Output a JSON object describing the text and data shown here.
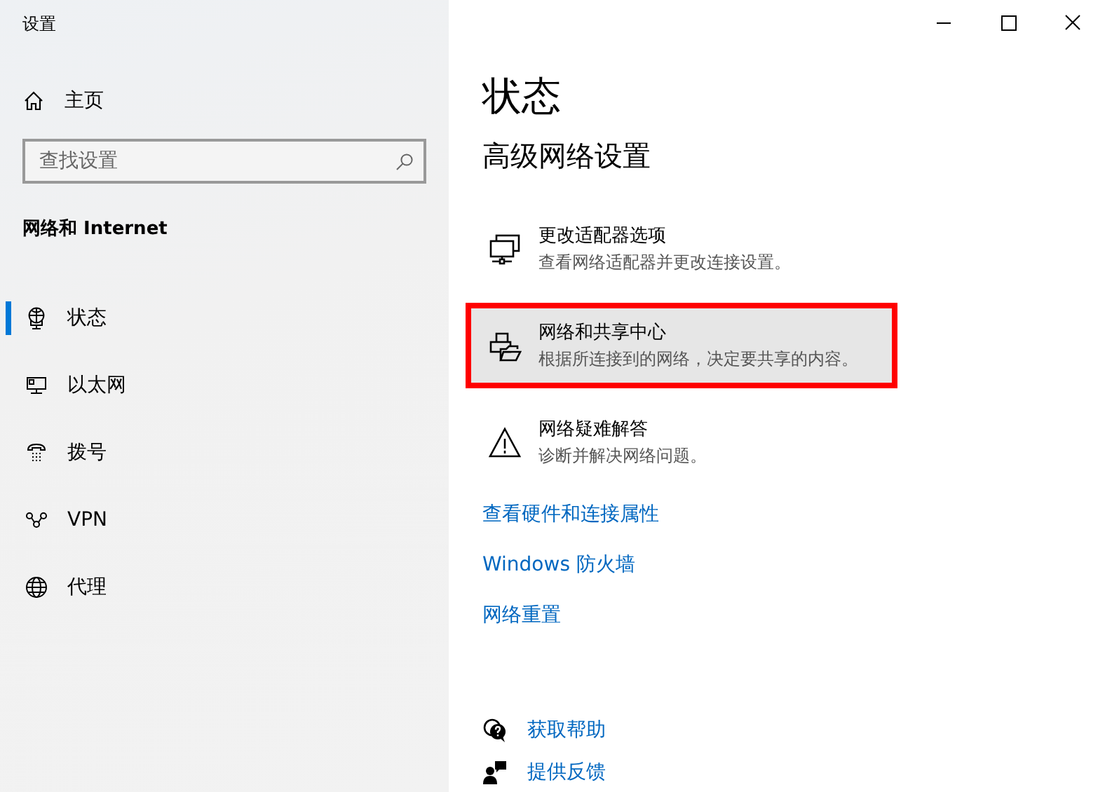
{
  "window": {
    "title": "设置"
  },
  "sidebar": {
    "home": "主页",
    "search": {
      "placeholder": "查找设置"
    },
    "section": "网络和 Internet",
    "items": [
      {
        "label": "状态",
        "selected": true
      },
      {
        "label": "以太网",
        "selected": false
      },
      {
        "label": "拨号",
        "selected": false
      },
      {
        "label": "VPN",
        "selected": false
      },
      {
        "label": "代理",
        "selected": false
      }
    ]
  },
  "page": {
    "title": "状态",
    "subtitle": "高级网络设置",
    "options": [
      {
        "title": "更改适配器选项",
        "description": "查看网络适配器并更改连接设置。",
        "highlighted": false
      },
      {
        "title": "网络和共享中心",
        "description": "根据所连接到的网络，决定要共享的内容。",
        "highlighted": true
      },
      {
        "title": "网络疑难解答",
        "description": "诊断并解决网络问题。",
        "highlighted": false
      }
    ],
    "links": [
      "查看硬件和连接属性",
      "Windows 防火墙",
      "网络重置"
    ],
    "help": [
      "获取帮助",
      "提供反馈"
    ]
  }
}
